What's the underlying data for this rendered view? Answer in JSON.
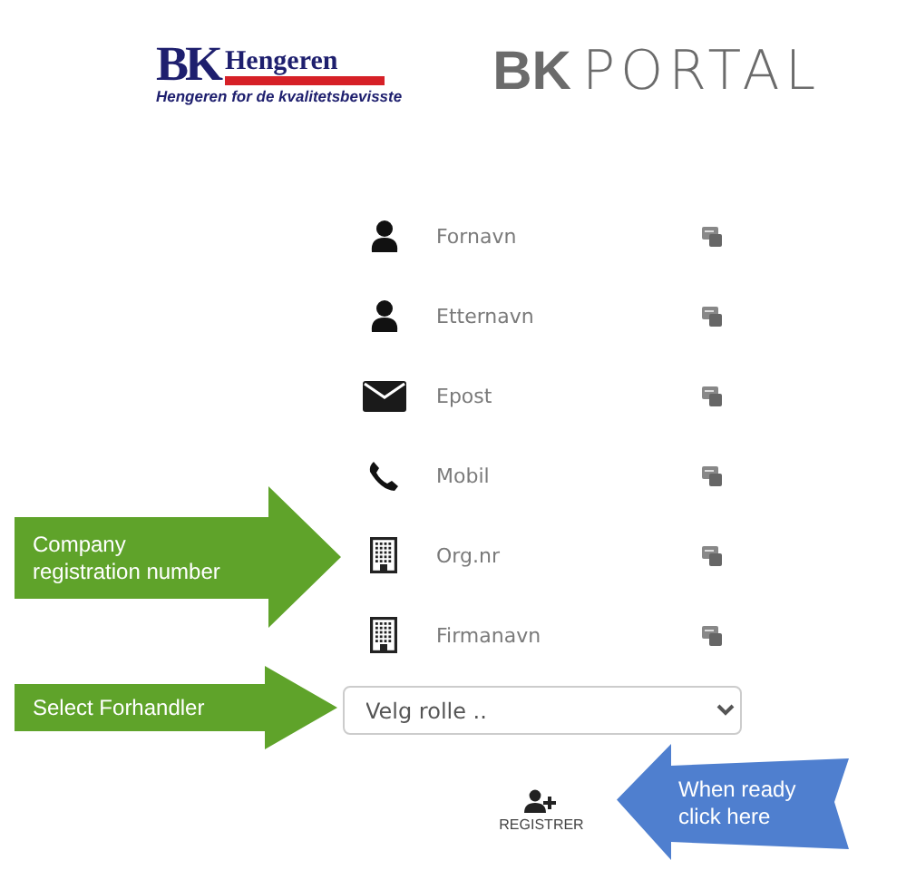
{
  "logo": {
    "initials": "BK",
    "name": "Hengeren",
    "tagline": "Hengeren for de kvalitetsbevisste"
  },
  "portal": {
    "brand": "BK",
    "name": "PORTAL"
  },
  "fields": [
    {
      "kind": "person",
      "placeholder": "Fornavn"
    },
    {
      "kind": "person",
      "placeholder": "Etternavn"
    },
    {
      "kind": "mail",
      "placeholder": "Epost"
    },
    {
      "kind": "phone",
      "placeholder": "Mobil"
    },
    {
      "kind": "building",
      "placeholder": "Org.nr"
    },
    {
      "kind": "building",
      "placeholder": "Firmanavn"
    }
  ],
  "role_select": {
    "value": "Velg rolle .."
  },
  "register_button": {
    "label": "REGISTRER"
  },
  "callouts": [
    {
      "kind": "right",
      "text": "Company registration number",
      "color": "#5fa32a"
    },
    {
      "kind": "right",
      "text": "Select Forhandler",
      "color": "#5fa32a"
    },
    {
      "kind": "left",
      "text": "When ready click here",
      "color": "#4f7fcf"
    }
  ]
}
